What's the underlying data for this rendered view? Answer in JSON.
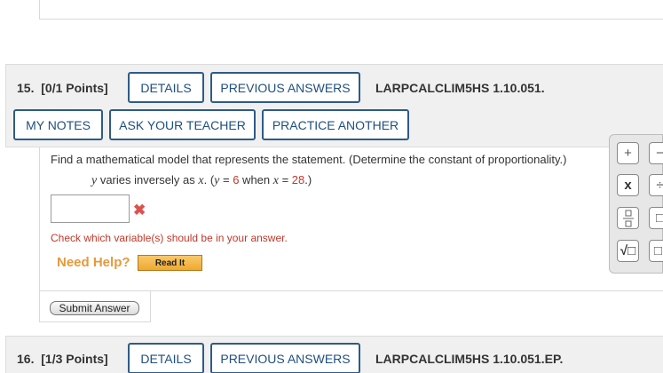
{
  "q15": {
    "number": "15.",
    "points": "[0/1 Points]",
    "details_label": "DETAILS",
    "previous_answers_label": "PREVIOUS ANSWERS",
    "code": "LARPCALCLIM5HS 1.10.051.",
    "my_notes_label": "MY NOTES",
    "ask_teacher_label": "ASK YOUR TEACHER",
    "practice_another_label": "PRACTICE ANOTHER",
    "prompt": "Find a mathematical model that represents the statement. (Determine the constant of proportionality.)",
    "statement": {
      "y_var": "y",
      "middle": " varies inversely as ",
      "x_var": "x",
      "after_x": ". (",
      "y_eq": "y",
      "eq1": " = ",
      "y_value": "6",
      "when": " when ",
      "x_eq": "x",
      "eq2": " = ",
      "x_value": "28",
      "close": ".)"
    },
    "answer_value": "",
    "wrong_mark": "✖",
    "check_message": "Check which variable(s) should be in your answer.",
    "need_help": "Need Help?",
    "read_it_label": "Read It",
    "submit_label": "Submit Answer"
  },
  "palette": {
    "plus": "+",
    "minus": "−",
    "times_x": "x",
    "divide": "÷",
    "fraction": "⁄",
    "power": "□",
    "sqrt": "√□",
    "factorial": "□!"
  },
  "q16": {
    "number": "16.",
    "points": "[1/3 Points]",
    "details_label": "DETAILS",
    "previous_answers_label": "PREVIOUS ANSWERS",
    "code": "LARPCALCLIM5HS 1.10.051.EP."
  },
  "colors": {
    "button_border": "#2e5b87",
    "error_red": "#c0392b",
    "help_orange": "#e59a3c"
  }
}
